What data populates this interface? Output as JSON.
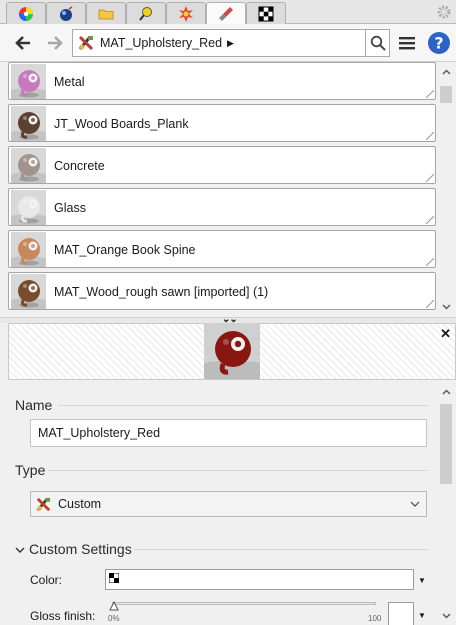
{
  "tabs": [
    {
      "name": "colors",
      "icon": "color-wheel-icon"
    },
    {
      "name": "materials",
      "icon": "materials-sphere-icon"
    },
    {
      "name": "components",
      "icon": "folder-icon"
    },
    {
      "name": "styles",
      "icon": "styles-icon"
    },
    {
      "name": "fog",
      "icon": "explosion-icon"
    },
    {
      "name": "paint",
      "icon": "paint-icon",
      "active": true
    },
    {
      "name": "texture",
      "icon": "checker-icon"
    }
  ],
  "toolbar": {
    "breadcrumb": "MAT_Upholstery_Red",
    "search_icon": "search-icon",
    "menu_icon": "menu-icon",
    "help_icon": "help-icon"
  },
  "materials": [
    {
      "label": "Metal",
      "color": "#c879be"
    },
    {
      "label": "JT_Wood Boards_Plank",
      "color": "#5a4132"
    },
    {
      "label": "Concrete",
      "color": "#a0948c"
    },
    {
      "label": "Glass",
      "color": "#e8e8e8"
    },
    {
      "label": "MAT_Orange Book Spine",
      "color": "#c8895a"
    },
    {
      "label": "MAT_Wood_rough sawn [imported] (1)",
      "color": "#7a4a2c"
    }
  ],
  "preview": {
    "color": "#8a1612"
  },
  "properties": {
    "name_label": "Name",
    "name_value": "MAT_Upholstery_Red",
    "type_label": "Type",
    "type_value": "Custom",
    "custom_settings_label": "Custom Settings",
    "color_label": "Color:",
    "gloss_label": "Gloss finish:",
    "gloss_min": "0%",
    "gloss_max": "100",
    "gloss_value": 0
  }
}
